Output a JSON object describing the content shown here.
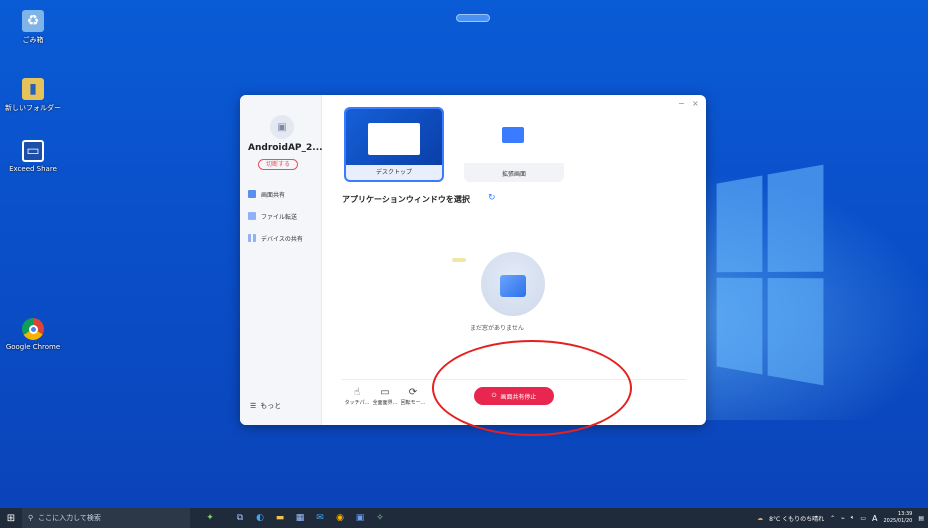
{
  "desktop": {
    "icons": [
      {
        "label": "ごみ箱",
        "icon": "recycle-bin-icon"
      },
      {
        "label": "新しいフォルダー",
        "icon": "folder-icon"
      },
      {
        "label": "Exceed Share",
        "icon": "exceed-share-icon"
      },
      {
        "label": "Google Chrome",
        "icon": "chrome-icon"
      }
    ]
  },
  "app": {
    "device_name": "AndroidAP_2...",
    "disconnect_label": "切断する",
    "nav": [
      {
        "label": "画面共有",
        "icon": "screen-share-icon"
      },
      {
        "label": "ファイル転送",
        "icon": "folder-icon"
      },
      {
        "label": "デバイスの共有",
        "icon": "grid-icon"
      }
    ],
    "more_label": "もっと",
    "window_controls": {
      "minimize": "−",
      "close": "×"
    },
    "modes": [
      {
        "label": "デスクトップ",
        "selected": true
      },
      {
        "label": "拡張画面",
        "selected": false
      }
    ],
    "section_title": "アプリケーションウィンドウを選択",
    "empty_text": "まだ窓がありません",
    "tools": [
      {
        "label": "タッチパ...",
        "icon": "touch-icon"
      },
      {
        "label": "全面面界...",
        "icon": "fullscreen-icon"
      },
      {
        "label": "回転モー...",
        "icon": "rotate-icon"
      }
    ],
    "stop_button": "画面共有停止"
  },
  "taskbar": {
    "search_placeholder": "ここに入力して検索",
    "weather": "8°C くもりのち晴れ",
    "ime": "A",
    "time": "13:39",
    "date": "2025/01/20"
  },
  "colors": {
    "accent": "#3a7bff",
    "danger": "#e8264f",
    "annotation": "#e61f1f"
  }
}
